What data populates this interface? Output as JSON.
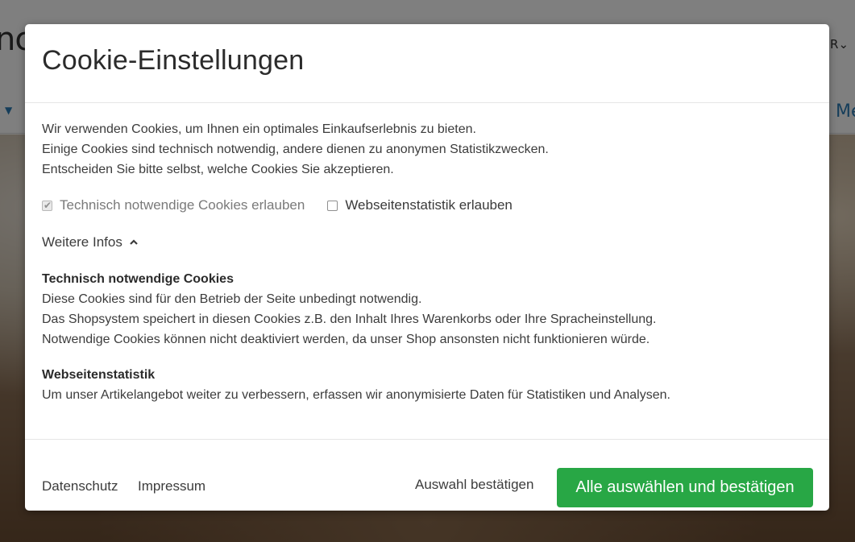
{
  "background": {
    "logo_fragment": "nc",
    "currency_fragment": "R",
    "nav_fragment": "Me"
  },
  "modal": {
    "title": "Cookie-Einstellungen",
    "intro": [
      "Wir verwenden Cookies, um Ihnen ein optimales Einkaufserlebnis zu bieten.",
      "Einige Cookies sind technisch notwendig, andere dienen zu anonymen Statistikzwecken.",
      "Entscheiden Sie bitte selbst, welche Cookies Sie akzeptieren."
    ],
    "options": [
      {
        "label": "Technisch notwendige Cookies erlauben",
        "checked": true,
        "disabled": true
      },
      {
        "label": "Webseitenstatistik erlauben",
        "checked": false,
        "disabled": false
      }
    ],
    "more_info_label": "Weitere Infos",
    "details": [
      {
        "heading": "Technisch notwendige Cookies",
        "lines": [
          "Diese Cookies sind für den Betrieb der Seite unbedingt notwendig.",
          "Das Shopsystem speichert in diesen Cookies z.B. den Inhalt Ihres Warenkorbs oder Ihre Spracheinstellung.",
          "Notwendige Cookies können nicht deaktiviert werden, da unser Shop ansonsten nicht funktionieren würde."
        ]
      },
      {
        "heading": "Webseitenstatistik",
        "lines": [
          "Um unser Artikelangebot weiter zu verbessern, erfassen wir anonymisierte Daten für Statistiken und Analysen."
        ]
      }
    ],
    "footer": {
      "privacy_label": "Datenschutz",
      "imprint_label": "Impressum",
      "confirm_selection_label": "Auswahl bestätigen",
      "accept_all_label": "Alle auswählen und bestätigen",
      "accept_all_color": "#28a745"
    }
  }
}
